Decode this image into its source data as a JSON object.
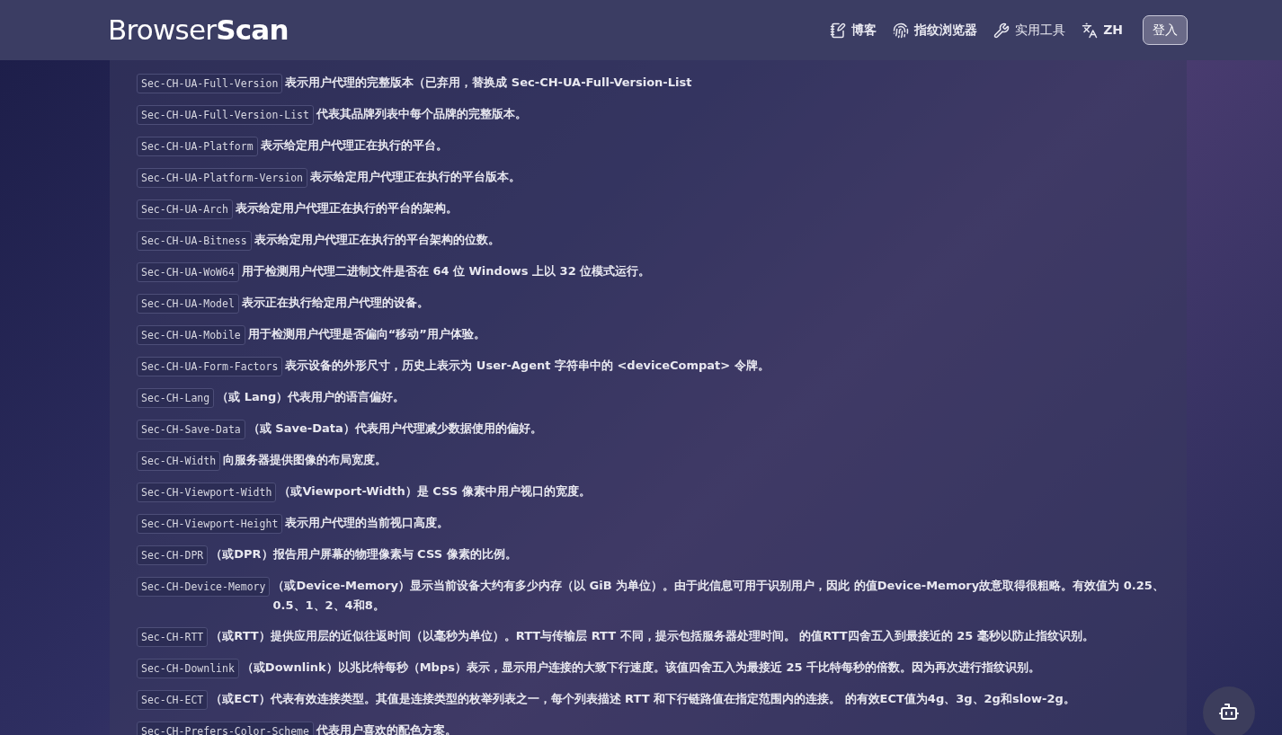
{
  "header": {
    "logo": {
      "light": "Browser",
      "bold": "Scan"
    },
    "nav": [
      {
        "kind": "blog",
        "label": "博客"
      },
      {
        "kind": "fingerprint",
        "label": "指纹浏览器"
      },
      {
        "kind": "tools",
        "label": "实用工具"
      },
      {
        "kind": "language",
        "label": "ZH"
      }
    ],
    "login": "登入"
  },
  "headers": [
    {
      "code": "Sec-CH-UA-Full-Version",
      "text": "表示用户代理的完整版本（已弃用，替换成 Sec-CH-UA-Full-Version-List"
    },
    {
      "code": "Sec-CH-UA-Full-Version-List",
      "text": "代表其品牌列表中每个品牌的完整版本。"
    },
    {
      "code": "Sec-CH-UA-Platform",
      "text": "表示给定用户代理正在执行的平台。"
    },
    {
      "code": "Sec-CH-UA-Platform-Version",
      "text": "表示给定用户代理正在执行的平台版本。"
    },
    {
      "code": "Sec-CH-UA-Arch",
      "text": "表示给定用户代理正在执行的平台的架构。"
    },
    {
      "code": "Sec-CH-UA-Bitness",
      "text": "表示给定用户代理正在执行的平台架构的位数。"
    },
    {
      "code": "Sec-CH-UA-WoW64",
      "text": "用于检测用户代理二进制文件是否在 64 位 Windows 上以 32 位模式运行。"
    },
    {
      "code": "Sec-CH-UA-Model",
      "text": "表示正在执行给定用户代理的设备。"
    },
    {
      "code": "Sec-CH-UA-Mobile",
      "text": "用于检测用户代理是否偏向“移动”用户体验。"
    },
    {
      "code": "Sec-CH-UA-Form-Factors",
      "text": "表示设备的外形尺寸，历史上表示为 User-Agent 字符串中的 <deviceCompat> 令牌。"
    },
    {
      "code": "Sec-CH-Lang",
      "text": "（或 Lang）代表用户的语言偏好。"
    },
    {
      "code": "Sec-CH-Save-Data",
      "text": " （或 Save-Data）代表用户代理减少数据使用的偏好。"
    },
    {
      "code": "Sec-CH-Width",
      "text": "向服务器提供图像的布局宽度。"
    },
    {
      "code": "Sec-CH-Viewport-Width",
      "text": " （或Viewport-Width）是 CSS 像素中用户视口的宽度。"
    },
    {
      "code": "Sec-CH-Viewport-Height",
      "text": "表示用户代理的当前视口高度。"
    },
    {
      "code": "Sec-CH-DPR",
      "text": " （或DPR）报告用户屏幕的物理像素与 CSS 像素的比例。"
    },
    {
      "code": "Sec-CH-Device-Memory",
      "text": " （或Device-Memory）显示当前设备大约有多少内存（以 GiB 为单位）。由于此信息可用于识别用户，因此 的值Device-Memory故意取得很粗略。有效值为 0.25、0.5、1、2、4和8。"
    },
    {
      "code": "Sec-CH-RTT",
      "text": " （或RTT）提供应用层的近似往返时间（以毫秒为单位）。RTT与传输层 RTT 不同，提示包括服务器处理时间。 的值RTT四舍五入到最接近的 25 毫秒以防止指纹识别。"
    },
    {
      "code": "Sec-CH-Downlink",
      "text": " （或Downlink）以兆比特每秒（Mbps）表示，显示用户连接的大致下行速度。该值四舍五入为最接近 25 千比特每秒的倍数。因为再次进行指纹识别。"
    },
    {
      "code": "Sec-CH-ECT",
      "text": " （或ECT）代表有效连接类型。其值是连接类型的枚举列表之一，每个列表描述 RTT 和下行链路值在指定范围内的连接。 的有效ECT值为4g、3g、2g和slow-2g。"
    },
    {
      "code": "Sec-CH-Prefers-Color-Scheme",
      "text": "代表用户喜欢的配色方案。"
    }
  ]
}
